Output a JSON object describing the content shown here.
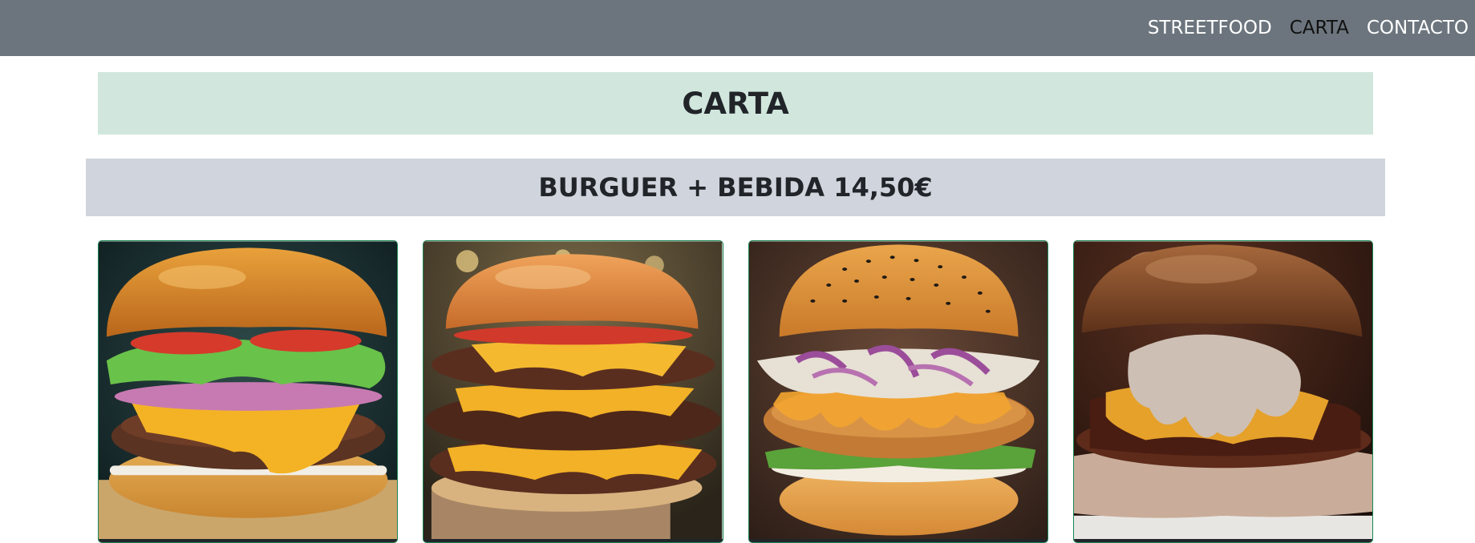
{
  "nav": {
    "links": [
      {
        "label": "STREETFOOD",
        "active": false
      },
      {
        "label": "CARTA",
        "active": true
      },
      {
        "label": "CONTACTO",
        "active": false
      }
    ]
  },
  "header": {
    "title": "CARTA"
  },
  "promo": {
    "label": "BURGUER + BEBIDA 14,50€"
  },
  "colors": {
    "navbar": "#6c757d",
    "title_bg": "#d1e7dd",
    "promo_bg": "#d0d4dc",
    "card_border": "#198754"
  },
  "menu": {
    "items": [
      {
        "image": "cheeseburger-lettuce-tomato"
      },
      {
        "image": "triple-smash-burger"
      },
      {
        "image": "crispy-chicken-burger"
      },
      {
        "image": "bacon-mushroom-sauce-burger"
      }
    ]
  }
}
